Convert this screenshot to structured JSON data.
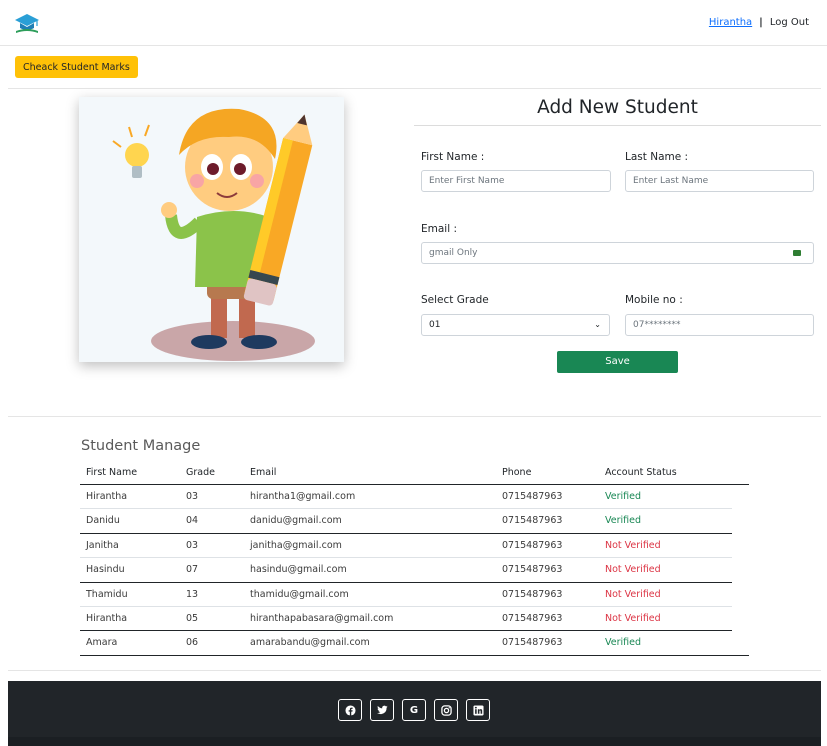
{
  "header": {
    "logo_icon": "graduation-cap-icon",
    "user_name": "Hirantha",
    "separator": "|",
    "logout_label": "Log Out"
  },
  "toolbar": {
    "check_marks_label": "Cheack Student Marks"
  },
  "form": {
    "title": "Add New Student",
    "first_name": {
      "label": "First Name :",
      "placeholder": "Enter First Name"
    },
    "last_name": {
      "label": "Last Name :",
      "placeholder": "Enter  Last Name"
    },
    "email": {
      "label": "Email :",
      "placeholder": "gmail Only",
      "icon": "email-icon"
    },
    "grade": {
      "label": "Select Grade",
      "value": "01"
    },
    "mobile": {
      "label": "Mobile no :",
      "placeholder": "07********"
    },
    "save_label": "Save"
  },
  "students": {
    "title": "Student Manage",
    "columns": [
      "First Name",
      "Grade",
      "Email",
      "Phone",
      "Account Status"
    ],
    "rows": [
      {
        "first_name": "Hirantha",
        "grade": "03",
        "email": "hirantha1@gmail.com",
        "phone": "0715487963",
        "status": "Verified"
      },
      {
        "first_name": "Danidu",
        "grade": "04",
        "email": "danidu@gmail.com",
        "phone": "0715487963",
        "status": "Verified"
      },
      {
        "first_name": "Janitha",
        "grade": "03",
        "email": "janitha@gmail.com",
        "phone": "0715487963",
        "status": "Not Verified"
      },
      {
        "first_name": "Hasindu",
        "grade": "07",
        "email": "hasindu@gmail.com",
        "phone": "0715487963",
        "status": "Not Verified"
      },
      {
        "first_name": "Thamidu",
        "grade": "13",
        "email": "thamidu@gmail.com",
        "phone": "0715487963",
        "status": "Not Verified"
      },
      {
        "first_name": "Hirantha",
        "grade": "05",
        "email": "hiranthapabasara@gmail.com",
        "phone": "0715487963",
        "status": "Not Verified"
      },
      {
        "first_name": "Amara",
        "grade": "06",
        "email": "amarabandu@gmail.com",
        "phone": "0715487963",
        "status": "Verified"
      }
    ]
  },
  "footer": {
    "social_icons": [
      "facebook-icon",
      "twitter-icon",
      "google-icon",
      "instagram-icon",
      "linkedin-icon"
    ]
  },
  "colors": {
    "warning": "#ffc107",
    "success": "#198754",
    "danger": "#dc3545",
    "link": "#0d6efd",
    "footer_bg": "#212529"
  }
}
